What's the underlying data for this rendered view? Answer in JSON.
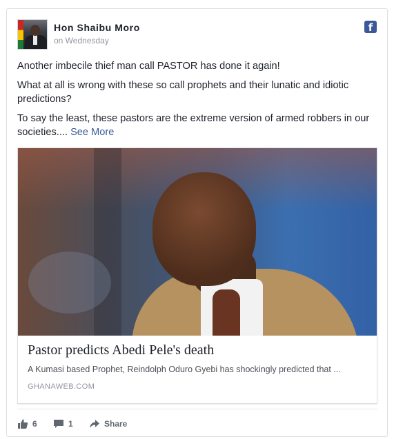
{
  "post": {
    "author": "Hon Shaibu Moro",
    "timestamp": "on Wednesday",
    "paragraphs": [
      "Another imbecile thief man call PASTOR has done it again!",
      "What at all is wrong with these so call prophets and their lunatic and idiotic predictions?",
      "To say the least, these pastors are the extreme version of armed robbers in our societies...."
    ],
    "see_more": "See More"
  },
  "link_preview": {
    "title": "Pastor predicts Abedi Pele's death",
    "description": "A Kumasi based Prophet, Reindolph Oduro Gyebi has shockingly predicted that ...",
    "domain": "GHANAWEB.COM"
  },
  "actions": {
    "likes": "6",
    "comments": "1",
    "share_label": "Share"
  },
  "colors": {
    "facebook_blue": "#3b5998",
    "link_blue": "#365899"
  },
  "icons": {
    "brand": "facebook-icon",
    "like": "thumbs-up-icon",
    "comment": "comment-icon",
    "share": "share-arrow-icon"
  }
}
